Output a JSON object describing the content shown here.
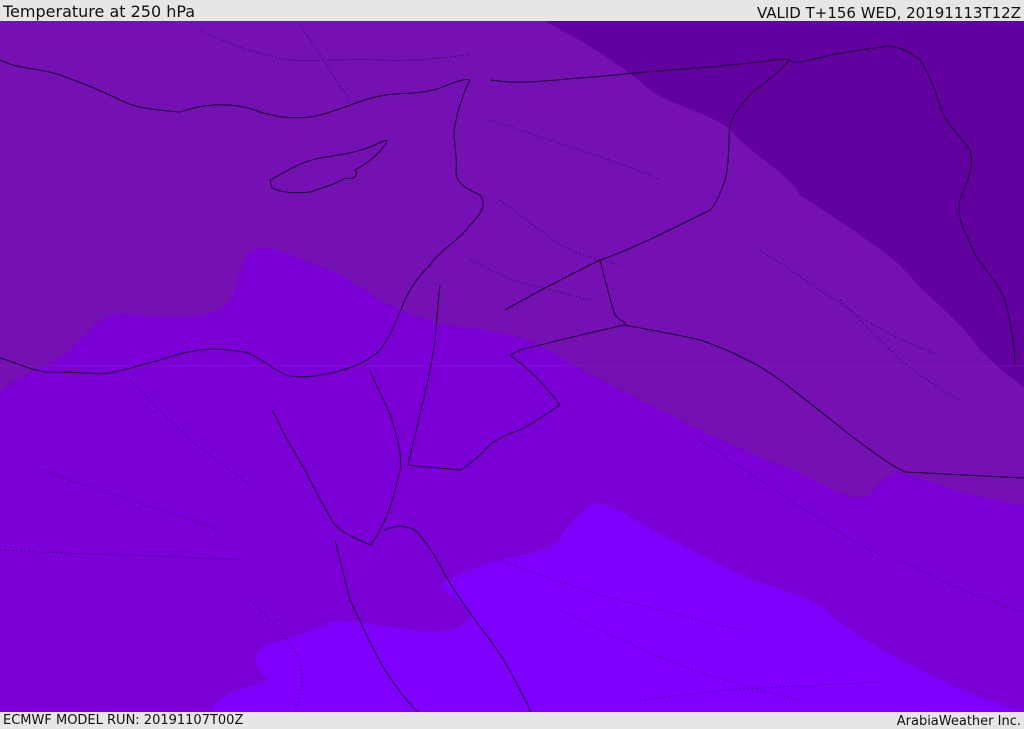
{
  "header": {
    "title": "Temperature at 250 hPa",
    "valid_time": "VALID T+156 WED, 20191113T12Z"
  },
  "footer": {
    "model_run": "ECMWF MODEL RUN: 20191107T00Z",
    "credit": "ArabiaWeather Inc."
  },
  "map": {
    "variable": "temperature",
    "pressure_level": "250 hPa",
    "colors": {
      "band_darkest": "#6300a0",
      "band_dark": "#7510b2",
      "band_mid": "#7a00d6",
      "band_light": "#8000ff",
      "borders": "#1a0033"
    }
  }
}
